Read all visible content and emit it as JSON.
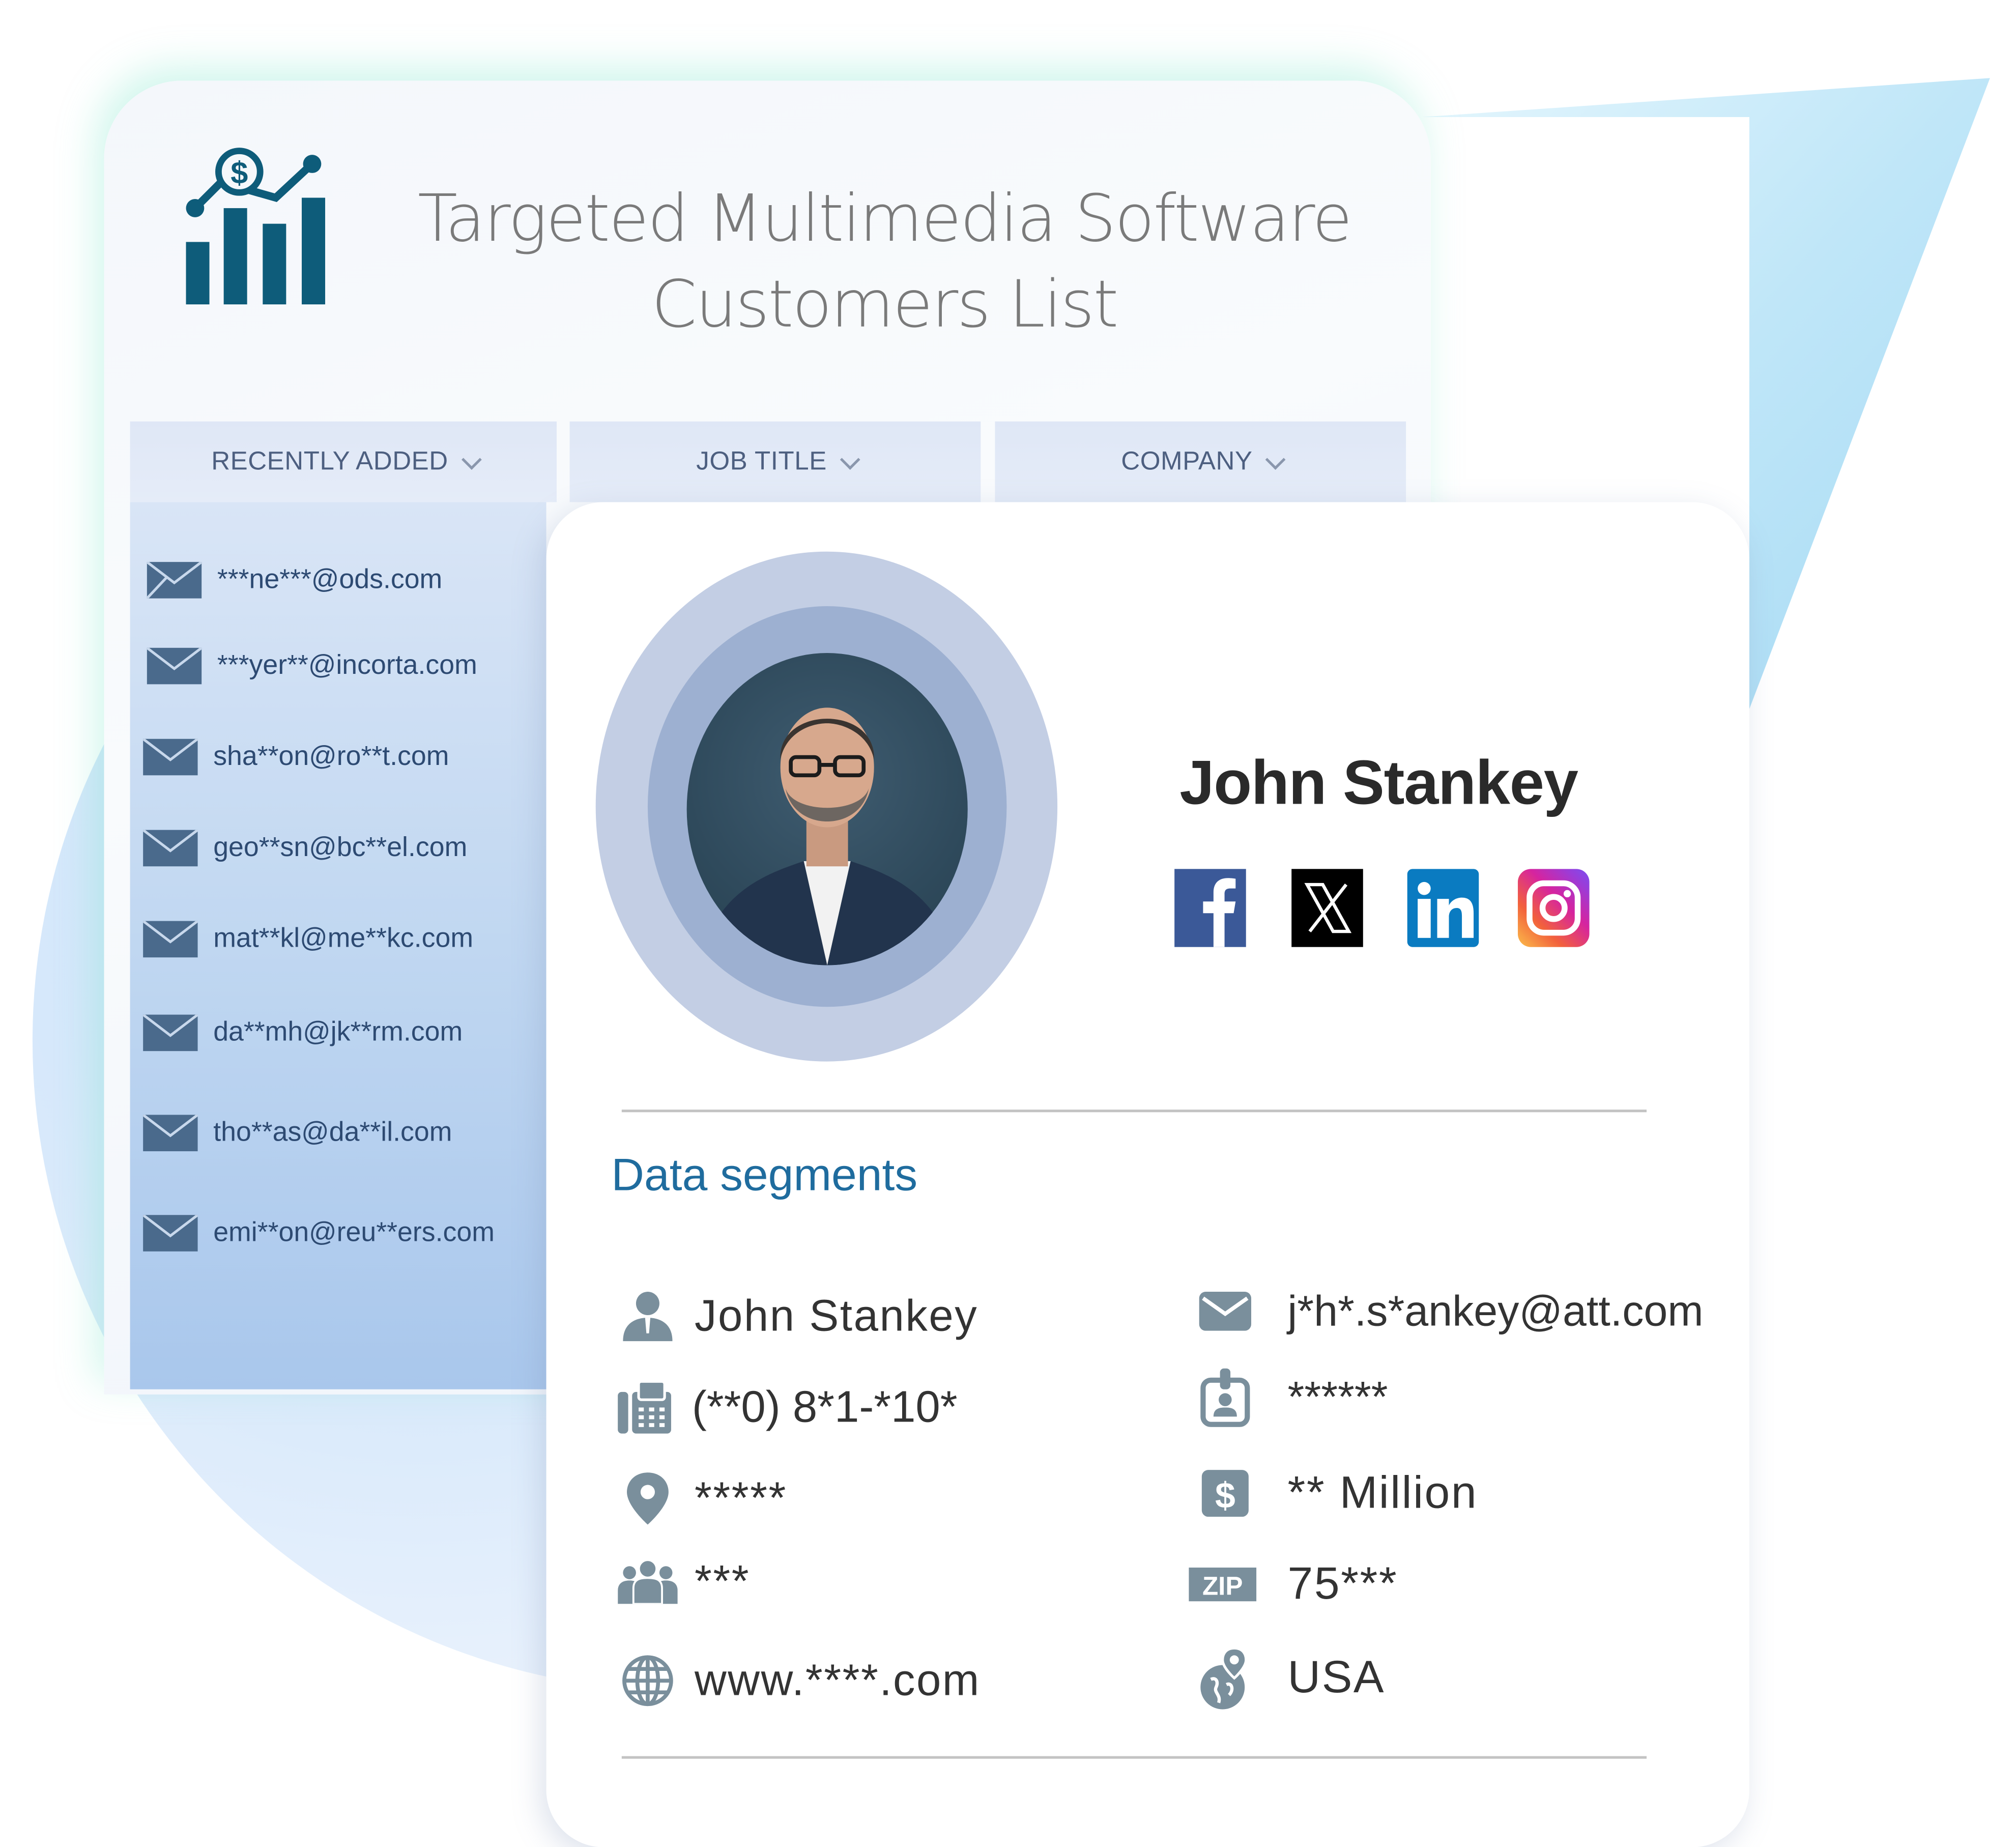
{
  "header": {
    "logo_icon": "chart-growth-dollar-icon",
    "title_line1": "Targeted Multimedia Software",
    "title_line2": "Customers List"
  },
  "tabs": [
    {
      "label": "RECENTLY ADDED",
      "icon": "chevron-down-icon"
    },
    {
      "label": "JOB TITLE",
      "icon": "chevron-down-icon"
    },
    {
      "label": "COMPANY",
      "icon": "chevron-down-icon"
    }
  ],
  "emails": [
    "***ne***@ods.com",
    "***yer**@incorta.com",
    "sha**on@ro**t.com",
    "geo**sn@bc**el.com",
    "mat**kl@me**kc.com",
    "da**mh@jk**rm.com",
    "tho**as@da**il.com",
    "emi**on@reu**ers.com"
  ],
  "profile": {
    "name": "John Stankey",
    "photo": "portrait-photo",
    "social": [
      {
        "name": "Facebook",
        "icon": "facebook-icon",
        "color": "#3b5998"
      },
      {
        "name": "X",
        "icon": "x-icon",
        "color": "#000000"
      },
      {
        "name": "LinkedIn",
        "icon": "linkedin-icon",
        "color": "#0a7bc1"
      },
      {
        "name": "Instagram",
        "icon": "instagram-icon",
        "color": "#d6249f"
      }
    ]
  },
  "segments": {
    "title": "Data segments",
    "left": [
      {
        "icon": "person-icon",
        "value": "John Stankey"
      },
      {
        "icon": "phone-fax-icon",
        "value": "(**0) 8*1-*10*"
      },
      {
        "icon": "location-pin-icon",
        "value": "*****"
      },
      {
        "icon": "group-icon",
        "value": "***"
      },
      {
        "icon": "globe-icon",
        "value": "www.****.com"
      }
    ],
    "right": [
      {
        "icon": "envelope-icon",
        "value": "j*h*.s*ankey@att.com"
      },
      {
        "icon": "id-badge-icon",
        "value": "******"
      },
      {
        "icon": "dollar-icon",
        "value": "** Million"
      },
      {
        "icon": "zip-icon",
        "value": "75***",
        "badge": "ZIP"
      },
      {
        "icon": "globe-pin-icon",
        "value": "USA"
      }
    ]
  },
  "colors": {
    "accent": "#1f6c9e",
    "logo": "#0e5c7a",
    "icon_gray": "#7a8f9c",
    "tab_text": "#4d5f80",
    "email_text": "#2d4a72"
  }
}
